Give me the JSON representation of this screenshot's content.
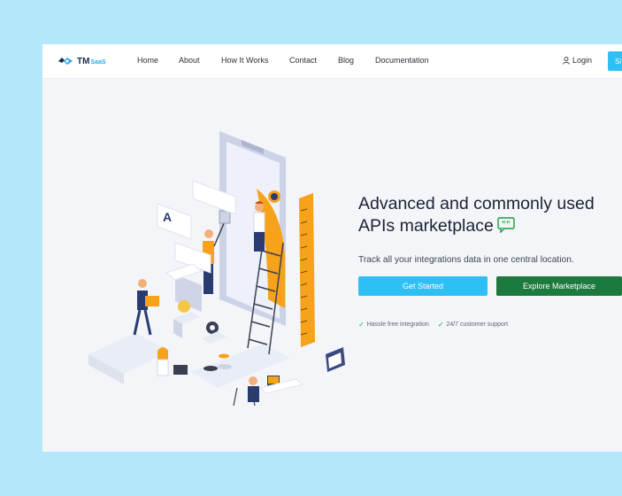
{
  "brand": {
    "name_main": "TM",
    "name_sub": "SaaS"
  },
  "nav": {
    "links": [
      "Home",
      "About",
      "How It Works",
      "Contact",
      "Blog",
      "Documentation"
    ],
    "login_label": "Login",
    "signup_label": "Si"
  },
  "hero": {
    "headline": "Advanced and commonly used APIs marketplace",
    "subtitle": "Track all your integrations data in one central location.",
    "primary_cta": "Get Started",
    "secondary_cta": "Explore Marketplace",
    "features": [
      "Hassle free integration",
      "24/7 customer support"
    ]
  },
  "colors": {
    "page_bg": "#b3e8fb",
    "accent_blue": "#2ec0f4",
    "accent_green": "#1d7a3e",
    "illustration_orange": "#f6a21b"
  }
}
